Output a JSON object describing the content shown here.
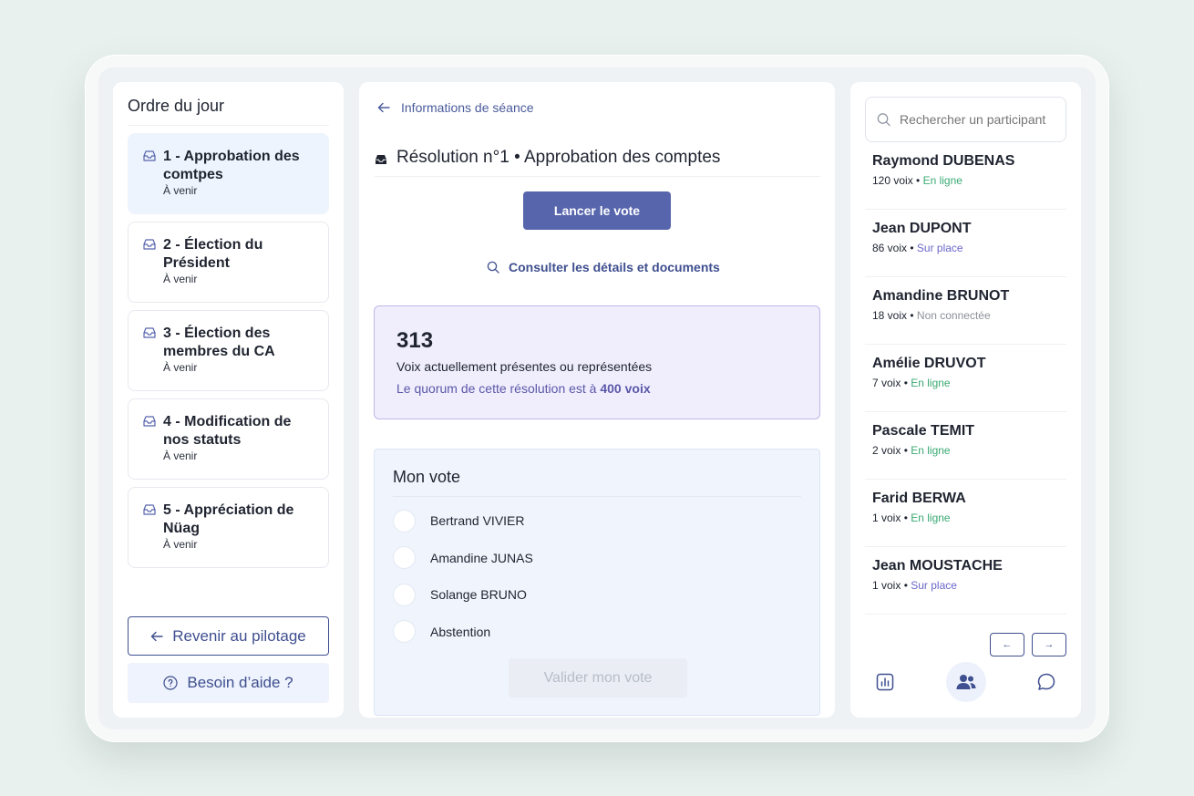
{
  "agenda": {
    "title": "Ordre du jour",
    "items": [
      {
        "title": "1 - Approbation des comtpes",
        "status": "À venir"
      },
      {
        "title": "2 - Élection du Président",
        "status": "À venir"
      },
      {
        "title": "3 - Élection des membres du CA",
        "status": "À venir"
      },
      {
        "title": "4 - Modification de nos statuts",
        "status": "À venir"
      },
      {
        "title": "5 - Appréciation de Nüag",
        "status": "À venir"
      }
    ],
    "back_label": "Revenir au pilotage",
    "help_label": "Besoin d’aide ?"
  },
  "main": {
    "breadcrumb": "Informations de séance",
    "resolution_title": "Résolution n°1 • Approbation des comptes",
    "launch_label": "Lancer le vote",
    "consult_label": "Consulter les détails et documents",
    "quorum": {
      "count": "313",
      "line1": "Voix actuellement présentes ou représentées",
      "line2_prefix": "Le quorum de cette résolution est à ",
      "line2_value": "400 voix"
    },
    "vote": {
      "title": "Mon vote",
      "options": [
        "Bertrand VIVIER",
        "Amandine JUNAS",
        "Solange BRUNO",
        "Abstention"
      ],
      "validate_label": "Valider mon vote"
    }
  },
  "participants": {
    "search_placeholder": "Rechercher un participant",
    "list": [
      {
        "name": "Raymond DUBENAS",
        "voices": "120 voix",
        "status": "En ligne"
      },
      {
        "name": "Jean DUPONT",
        "voices": "86 voix",
        "status": "Sur place"
      },
      {
        "name": "Amandine BRUNOT",
        "voices": "18 voix",
        "status": "Non connectée"
      },
      {
        "name": "Amélie DRUVOT",
        "voices": "7 voix",
        "status": "En ligne"
      },
      {
        "name": "Pascale TEMIT",
        "voices": "2 voix",
        "status": "En ligne"
      },
      {
        "name": "Farid BERWA",
        "voices": "1 voix",
        "status": "En ligne"
      },
      {
        "name": "Jean MOUSTACHE",
        "voices": "1 voix",
        "status": "Sur place"
      }
    ],
    "separator": " • ",
    "pager_prev": "←",
    "pager_next": "→",
    "tabs": [
      "chart-icon",
      "users-icon",
      "chat-icon"
    ]
  }
}
